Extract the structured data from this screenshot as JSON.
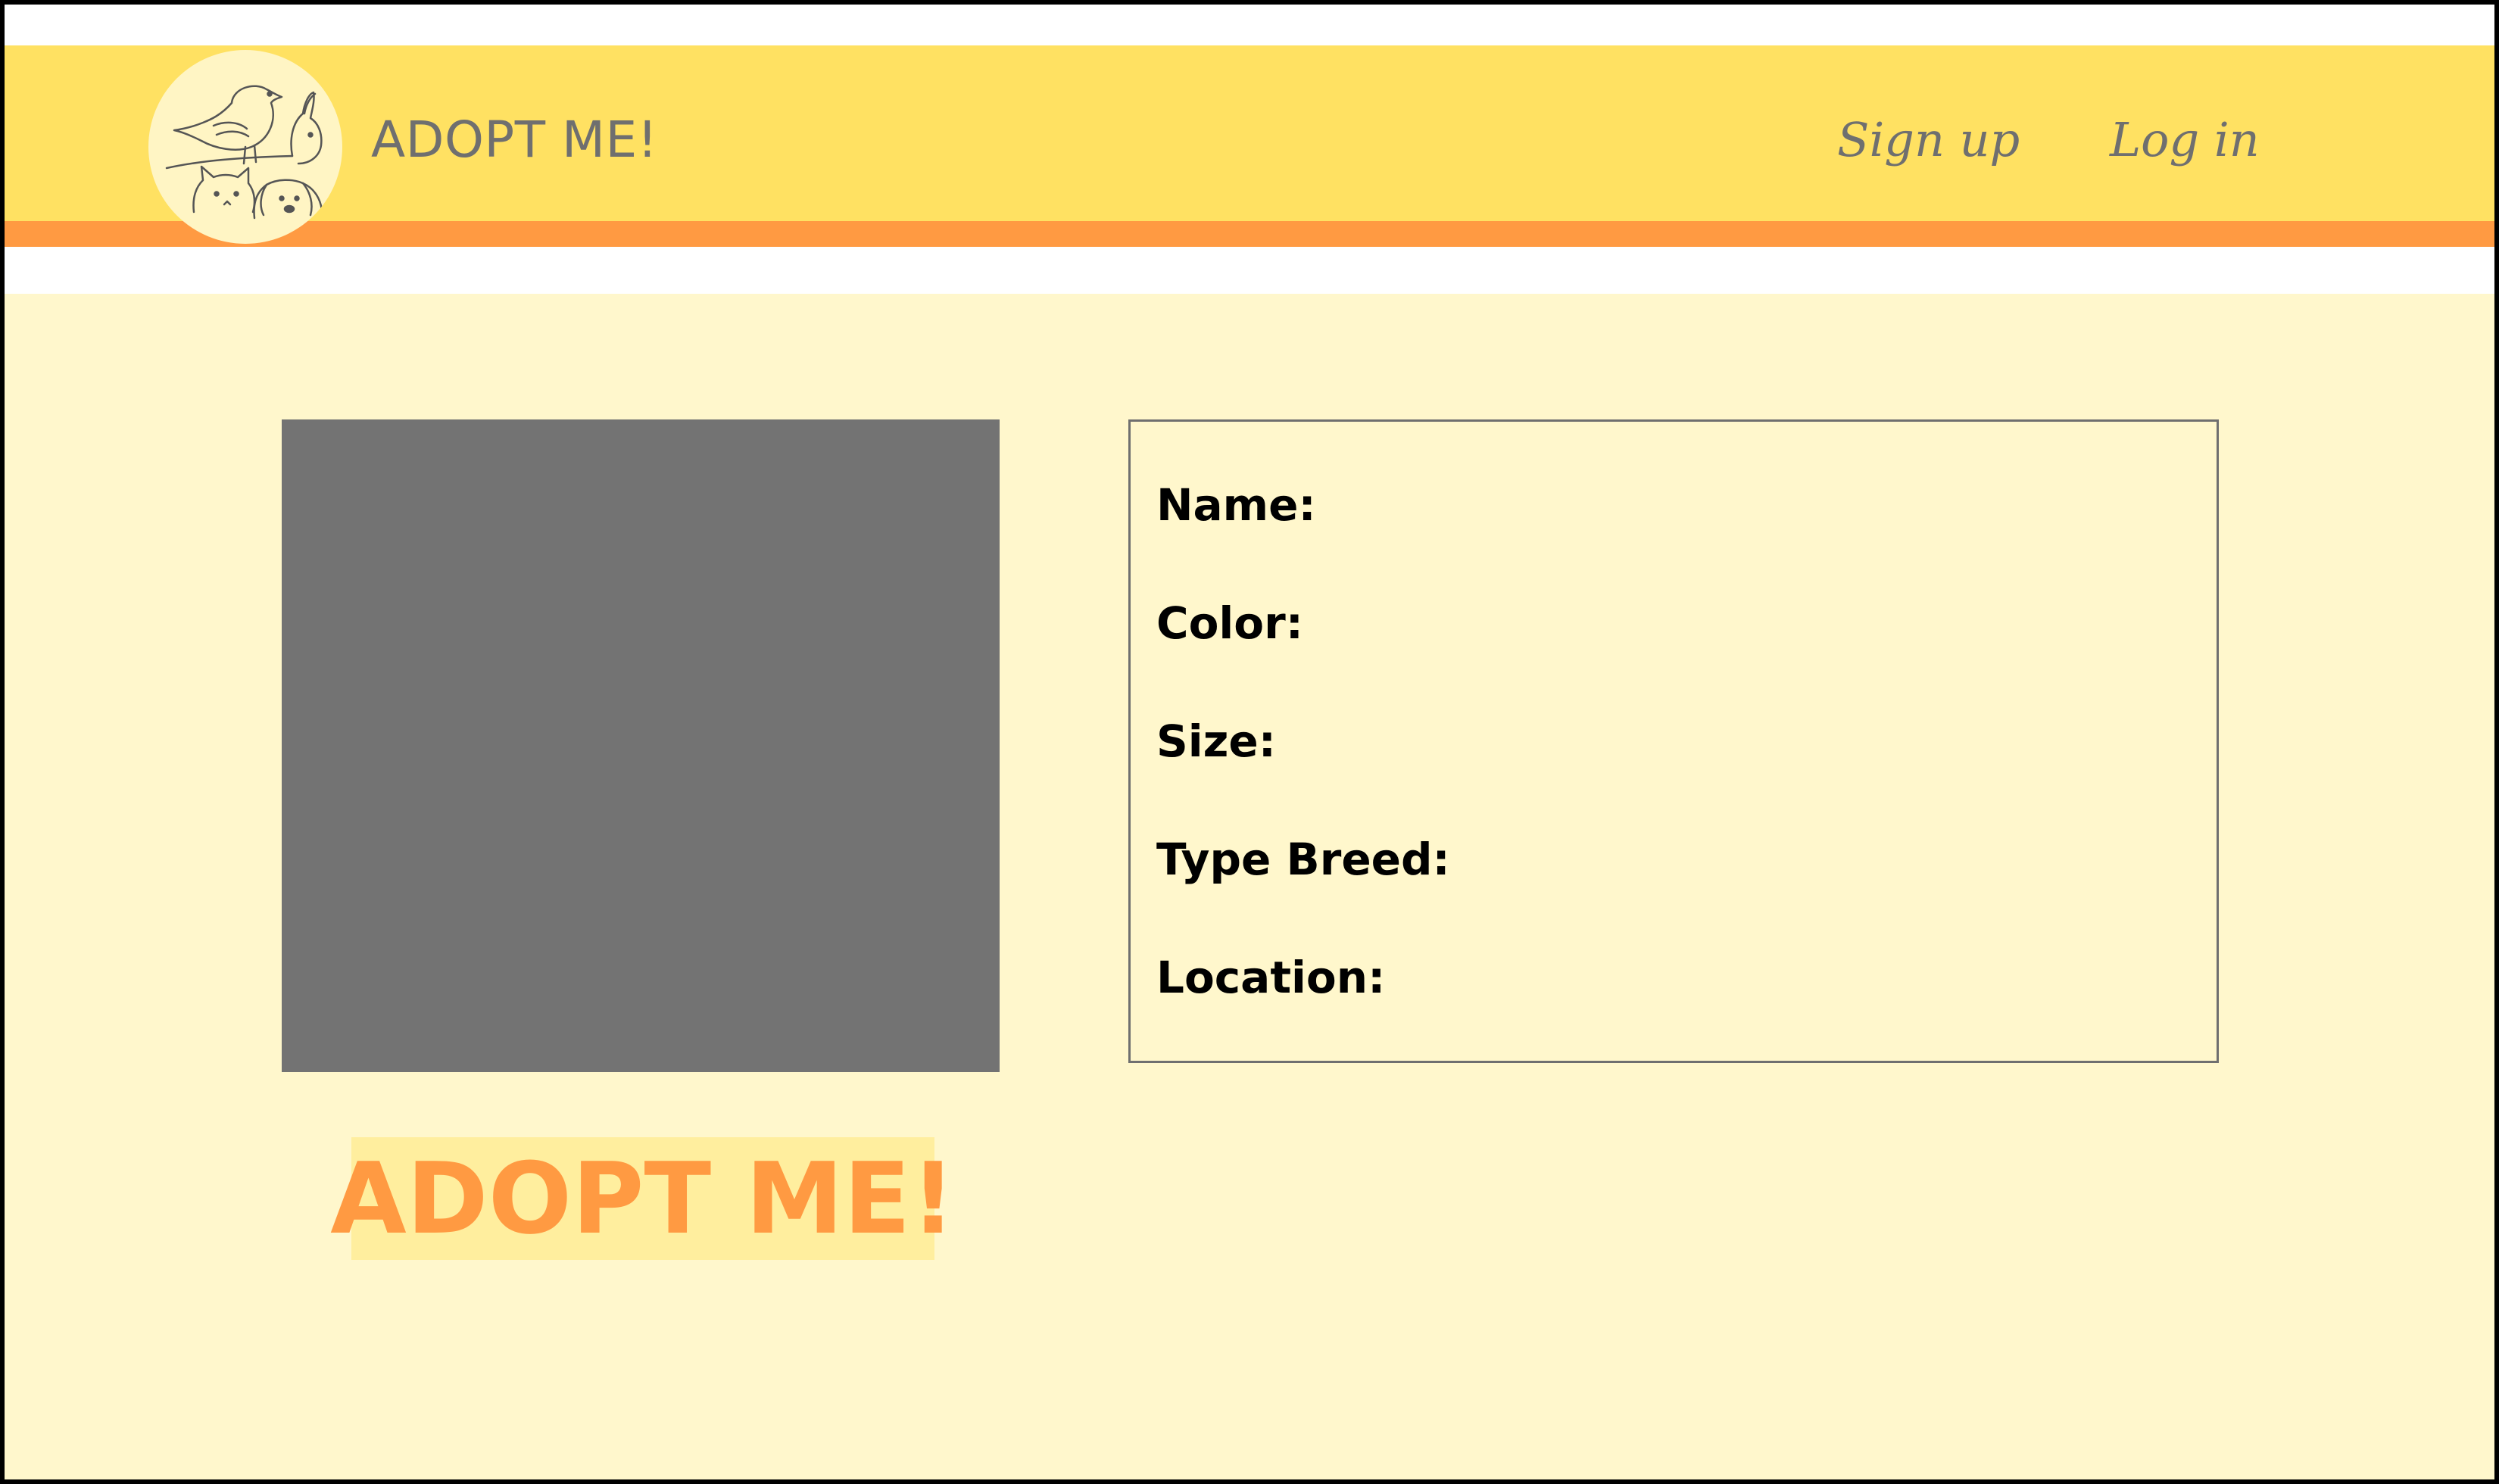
{
  "header": {
    "site_title": "ADOPT ME!",
    "logo_icon": "pets-logo-icon",
    "nav": {
      "signup_label": "Sign up",
      "login_label": "Log in"
    }
  },
  "main": {
    "photo": {
      "icon": "image-placeholder"
    },
    "details": {
      "name_label": "Name:",
      "color_label": "Color:",
      "size_label": "Size:",
      "breed_label": "Type Breed:",
      "location_label": "Location:"
    },
    "adopt_button_label": "ADOPT ME!"
  },
  "colors": {
    "header_bg": "#ffe162",
    "header_stripe": "#ff9a42",
    "content_bg": "#fff7cc",
    "photo_placeholder": "#737373",
    "accent_text": "#ff9a42",
    "nav_text": "#6f6f6f"
  }
}
